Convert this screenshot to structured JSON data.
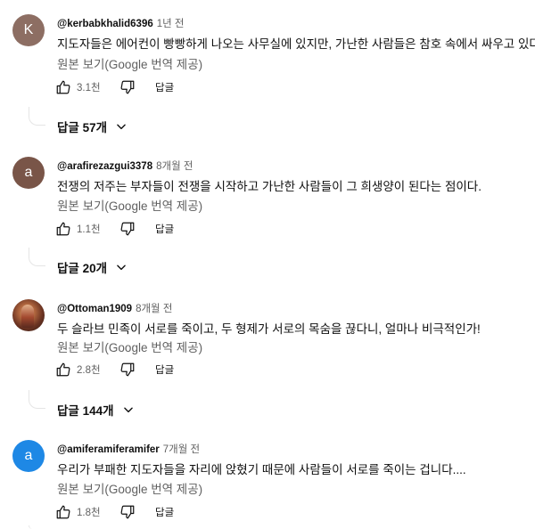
{
  "translate_label": "원본 보기(Google 번역 제공)",
  "reply_label": "답글",
  "colors": {
    "avatar_k": "#8d6e63",
    "avatar_a1": "#795548",
    "avatar_a2": "#1e88e5",
    "text_primary": "#0f0f0f",
    "text_secondary": "#606060"
  },
  "comments": [
    {
      "avatar_letter": "K",
      "username": "@kerbabkhalid6396",
      "time": "1년 전",
      "text": "지도자들은 에어컨이 빵빵하게 나오는 사무실에 있지만, 가난한 사람들은 참호 속에서 싸우고 있다.",
      "likes": "3.1천",
      "replies": "답글 57개"
    },
    {
      "avatar_letter": "a",
      "username": "@arafirezazgui3378",
      "time": "8개월 전",
      "text": "전쟁의 저주는 부자들이 전쟁을 시작하고 가난한 사람들이 그 희생양이 된다는 점이다.",
      "likes": "1.1천",
      "replies": "답글 20개"
    },
    {
      "avatar_letter": "",
      "username": "@Ottoman1909",
      "time": "8개월 전",
      "text": "두 슬라브 민족이 서로를 죽이고, 두 형제가 서로의 목숨을 끊다니, 얼마나 비극적인가!",
      "likes": "2.8천",
      "replies": "답글 144개"
    },
    {
      "avatar_letter": "a",
      "username": "@amiferamiferamifer",
      "time": "7개월 전",
      "text": "우리가 부패한 지도자들을 자리에 앉혔기 때문에 사람들이 서로를 죽이는 겁니다....",
      "likes": "1.8천",
      "replies": ""
    }
  ]
}
